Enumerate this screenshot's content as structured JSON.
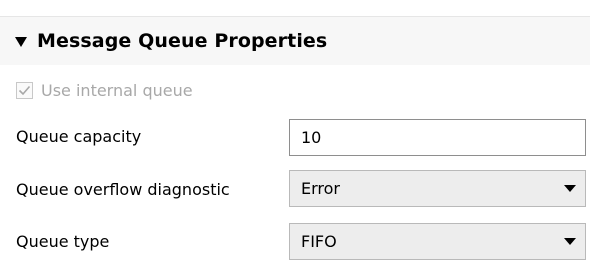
{
  "section": {
    "title": "Message Queue Properties",
    "expanded": true
  },
  "use_internal_queue": {
    "label": "Use internal queue",
    "checked": true,
    "disabled": true
  },
  "queue_capacity": {
    "label": "Queue capacity",
    "value": "10"
  },
  "queue_overflow_diagnostic": {
    "label": "Queue overflow diagnostic",
    "selected": "Error"
  },
  "queue_type": {
    "label": "Queue type",
    "selected": "FIFO"
  },
  "icons": {
    "expand": "triangle-down-icon",
    "check": "checkmark-icon",
    "dropdown": "chevron-down-icon"
  },
  "colors": {
    "header_bg": "#f7f7f7",
    "disabled_text": "#a8a8a8",
    "dropdown_bg": "#ededed"
  }
}
